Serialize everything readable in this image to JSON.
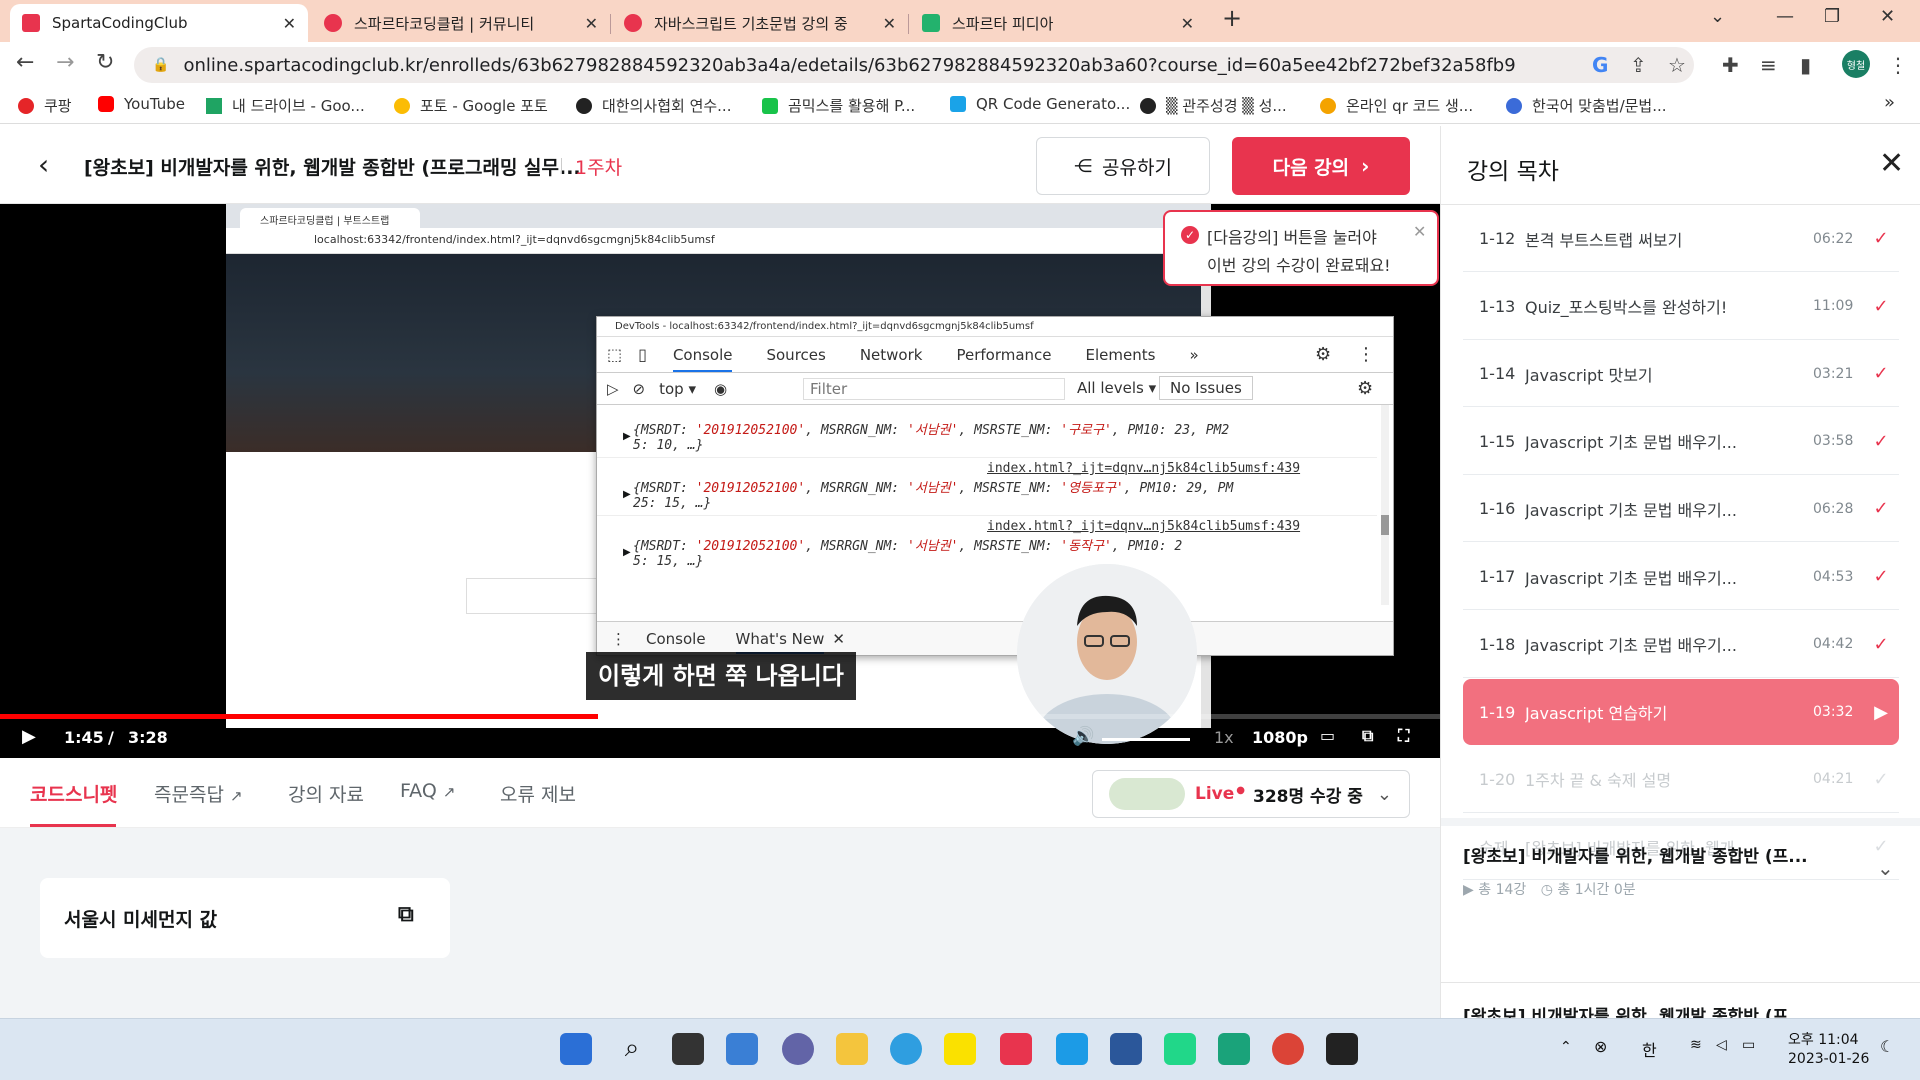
{
  "browser": {
    "tabs": [
      {
        "title": "SpartaCodingClub",
        "active": true
      },
      {
        "title": "스파르타코딩클럽 | 커뮤니티",
        "active": false
      },
      {
        "title": "자바스크립트 기초문법 강의 중",
        "active": false
      },
      {
        "title": "스파르타 피디아",
        "active": false
      }
    ],
    "url": "online.spartacodingclub.kr/enrolleds/63b627982884592320ab3a4a/edetails/63b627982884592320ab3a60?course_id=60a5ee42bf272bef32a58fb9",
    "profile_label": "형철",
    "bookmarks": [
      "쿠팡",
      "YouTube",
      "내 드라이브 - Goo...",
      "포토 - Google 포토",
      "대한의사협회 연수...",
      "곰믹스를 활용해 P...",
      "QR Code Generato...",
      "▒ 관주성경 ▒ 성...",
      "온라인 qr 코드 생...",
      "한국어 맞춤법/문법..."
    ],
    "more_bookmarks": "»"
  },
  "header": {
    "course_title": "[왕초보] 비개발자를 위한, 웹개발 종합반 (프로그래밍 실무...",
    "week": "1주차",
    "share_label": "공유하기",
    "next_label": "다음 강의"
  },
  "video": {
    "inner_browser": {
      "tab_title": "스파르타코딩클럽 | 부트스트랩",
      "url": "localhost:63342/frontend/index.html?_ijt=dqnvd6sgcmgnj5k84clib5umsf"
    },
    "devtools": {
      "title": "DevTools - localhost:63342/frontend/index.html?_ijt=dqnvd6sgcmgnj5k84clib5umsf",
      "tabs": [
        "Console",
        "Sources",
        "Network",
        "Performance",
        "Elements"
      ],
      "more_tabs": "»",
      "context": "top",
      "filter_placeholder": "Filter",
      "levels": "All levels",
      "issues": "No Issues",
      "logs": [
        {
          "pre": "{MSRDT: ",
          "date": "'201912052100'",
          "mid": ", MSRRGN_NM: ",
          "region": "'서남권'",
          "mid2": ", MSRSTE_NM: ",
          "district": "'구로구'",
          "post": ", PM10: 23, PM2",
          "post2": "5: 10, …}",
          "link": ""
        },
        {
          "pre": "{MSRDT: ",
          "date": "'201912052100'",
          "mid": ", MSRRGN_NM: ",
          "region": "'서남권'",
          "mid2": ", MSRSTE_NM: ",
          "district": "'영등포구'",
          "post": ", PM10: 29, PM",
          "post2": "25: 15, …}",
          "link": "index.html?_ijt=dqnv…nj5k84clib5umsf:439"
        },
        {
          "pre": "{MSRDT: ",
          "date": "'201912052100'",
          "mid": ", MSRRGN_NM: ",
          "region": "'서남권'",
          "mid2": ", MSRSTE_NM: ",
          "district": "'동작구'",
          "post": ", PM10: 2",
          "post2": "5: 15, …}",
          "link": "index.html?_ijt=dqnv…nj5k84clib5umsf:439"
        }
      ],
      "drawer_tabs": [
        "Console",
        "What's New"
      ]
    },
    "notice_line1": "[다음강의] 버튼을 눌러야",
    "notice_line2": "이번 강의 수강이 완료돼요!",
    "subtitle": "이렇게 하면 쭉 나옵니다",
    "time_current": "1:45",
    "time_sep": "/",
    "time_total": "3:28",
    "progress": 0.415,
    "speed": "1x",
    "quality": "1080p"
  },
  "subtabs": {
    "items": [
      "코드스니펫",
      "즉문즉답",
      "강의 자료",
      "FAQ",
      "오류 제보"
    ],
    "live_label": "Live",
    "live_count": "328명 수강 중"
  },
  "snippet": {
    "title": "서울시 미세먼지 값"
  },
  "toc": {
    "title": "강의 목차",
    "lessons": [
      {
        "no": "1-12",
        "name": "본격 부트스트랩 써보기",
        "time": "06:22",
        "mark": "✓",
        "state": "done"
      },
      {
        "no": "1-13",
        "name": "Quiz_포스팅박스를 완성하기!",
        "time": "11:09",
        "mark": "✓",
        "state": "done"
      },
      {
        "no": "1-14",
        "name": "Javascript 맛보기",
        "time": "03:21",
        "mark": "✓",
        "state": "done"
      },
      {
        "no": "1-15",
        "name": "Javascript 기초 문법 배우기...",
        "time": "03:58",
        "mark": "✓",
        "state": "done"
      },
      {
        "no": "1-16",
        "name": "Javascript 기초 문법 배우기...",
        "time": "06:28",
        "mark": "✓",
        "state": "done"
      },
      {
        "no": "1-17",
        "name": "Javascript 기초 문법 배우기...",
        "time": "04:53",
        "mark": "✓",
        "state": "done"
      },
      {
        "no": "1-18",
        "name": "Javascript 기초 문법 배우기...",
        "time": "04:42",
        "mark": "✓",
        "state": "done"
      },
      {
        "no": "1-19",
        "name": "Javascript 연습하기",
        "time": "03:32",
        "mark": "▶",
        "state": "current"
      },
      {
        "no": "1-20",
        "name": "1주차 끝 & 숙제 설명",
        "time": "04:21",
        "mark": "✓",
        "state": "dim"
      },
      {
        "no": "숙제",
        "name": "[왕초보] 비개발자를 위한, 웹개...",
        "time": "",
        "mark": "✓",
        "state": "dim"
      }
    ],
    "course_card_title": "[왕초보] 비개발자를 위한, 웹개발 종합반 (프...",
    "course_card_lessons": "총 14강",
    "course_card_duration": "총 1시간 0분",
    "next_card_title": "[왕초보] 비개발자를 위한, 웹개발 종합반 (프..."
  },
  "taskbar": {
    "time": "오후 11:04",
    "date": "2023-01-26",
    "ime": "한"
  },
  "colors": {
    "brand": "#e8344e",
    "current_lesson": "#f2707f"
  }
}
